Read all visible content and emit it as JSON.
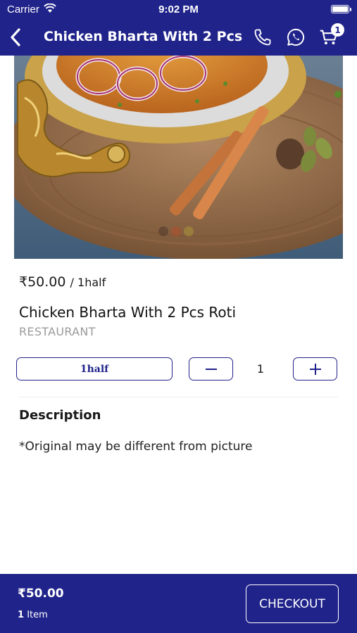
{
  "status_bar": {
    "carrier": "Carrier",
    "time": "9:02 PM"
  },
  "nav": {
    "title": "Chicken Bharta With 2 Pcs ...",
    "cart_count": "1"
  },
  "product": {
    "price": "₹50.00",
    "unit": "/ 1half",
    "name": "Chicken Bharta With 2 Pcs Roti",
    "category": "RESTAURANT",
    "variant": "1half",
    "quantity": "1"
  },
  "description": {
    "heading": "Description",
    "text": "*Original may be different from picture"
  },
  "footer": {
    "total": "₹50.00",
    "item_count": "1",
    "item_label": "Item",
    "checkout_label": "CHECKOUT"
  },
  "colors": {
    "brand": "#20238a",
    "background": "#ffffff",
    "muted_text": "#9a9a9a"
  },
  "icons": [
    "back-arrow-icon",
    "phone-icon",
    "whatsapp-icon",
    "cart-icon",
    "minus-icon",
    "plus-icon",
    "wifi-icon",
    "battery-icon"
  ]
}
